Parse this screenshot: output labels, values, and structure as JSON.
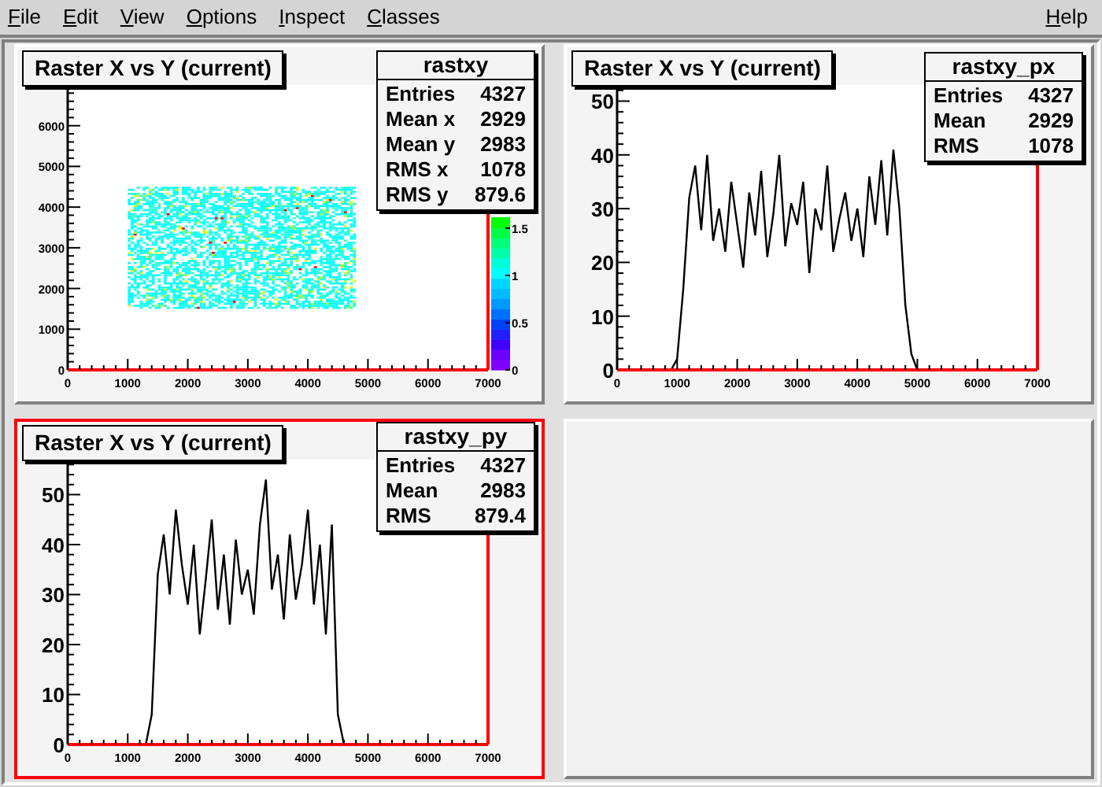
{
  "menu": {
    "items": [
      "File",
      "Edit",
      "View",
      "Options",
      "Inspect",
      "Classes"
    ],
    "help": "Help"
  },
  "pads": [
    {
      "kind": "hist2d",
      "selected": false,
      "title": "Raster X vs Y (current)",
      "stats": {
        "name": "rastxy",
        "rows": [
          {
            "label": "Entries",
            "value": "4327"
          },
          {
            "label": "Mean x",
            "value": "2929"
          },
          {
            "label": "Mean y",
            "value": "2983"
          },
          {
            "label": "RMS x",
            "value": "1078"
          },
          {
            "label": "RMS y",
            "value": "879.6"
          }
        ]
      },
      "palette_ticks": [
        "1.5",
        "1",
        "0.5",
        "0"
      ],
      "axes": {
        "xticks": [
          "0",
          "1000",
          "2000",
          "3000",
          "4000",
          "5000",
          "6000",
          "7000"
        ],
        "yticks": [
          "6000",
          "5000",
          "4000",
          "3000",
          "2000",
          "1000",
          "0"
        ]
      }
    },
    {
      "kind": "hist1d",
      "selected": false,
      "title": "Raster X vs Y (current)",
      "stats": {
        "name": "rastxy_px",
        "rows": [
          {
            "label": "Entries",
            "value": "4327"
          },
          {
            "label": "Mean",
            "value": "2929"
          },
          {
            "label": "RMS",
            "value": "1078"
          }
        ]
      },
      "chart_data": {
        "type": "line",
        "xlim": [
          0,
          7000
        ],
        "ylim": [
          0,
          53
        ],
        "xticks": [
          0,
          1000,
          2000,
          3000,
          4000,
          5000,
          6000,
          7000
        ],
        "yticks": [
          0,
          10,
          20,
          30,
          40,
          50
        ],
        "x": [
          0,
          100,
          200,
          300,
          400,
          500,
          600,
          700,
          800,
          900,
          1000,
          1100,
          1200,
          1300,
          1400,
          1500,
          1600,
          1700,
          1800,
          1900,
          2000,
          2100,
          2200,
          2300,
          2400,
          2500,
          2600,
          2700,
          2800,
          2900,
          3000,
          3100,
          3200,
          3300,
          3400,
          3500,
          3600,
          3700,
          3800,
          3900,
          4000,
          4100,
          4200,
          4300,
          4400,
          4500,
          4600,
          4700,
          4800,
          4900,
          5000,
          5100,
          5200,
          5300,
          5400,
          5500,
          5600,
          5700,
          5800,
          5900,
          6000,
          6100,
          6200,
          6300,
          6400,
          6500,
          6600,
          6700,
          6800,
          6900
        ],
        "series": [
          {
            "color": "#000000",
            "values": [
              0,
              0,
              0,
              0,
              0,
              0,
              0,
              0,
              0,
              0,
              2,
              15,
              32,
              38,
              26,
              40,
              24,
              30,
              22,
              35,
              27,
              19,
              33,
              25,
              37,
              21,
              29,
              40,
              23,
              31,
              27,
              35,
              18,
              30,
              26,
              38,
              22,
              28,
              33,
              24,
              30,
              21,
              36,
              27,
              39,
              25,
              41,
              30,
              12,
              3,
              0,
              0,
              0,
              0,
              0,
              0,
              0,
              0,
              0,
              0,
              0,
              0,
              0,
              0,
              0,
              0,
              0,
              0,
              0,
              0
            ]
          }
        ]
      }
    },
    {
      "kind": "hist1d",
      "selected": true,
      "title": "Raster X vs Y (current)",
      "stats": {
        "name": "rastxy_py",
        "rows": [
          {
            "label": "Entries",
            "value": "4327"
          },
          {
            "label": "Mean",
            "value": "2983"
          },
          {
            "label": "RMS",
            "value": "879.4"
          }
        ]
      },
      "chart_data": {
        "type": "line",
        "xlim": [
          0,
          7000
        ],
        "ylim": [
          0,
          57
        ],
        "xticks": [
          0,
          1000,
          2000,
          3000,
          4000,
          5000,
          6000,
          7000
        ],
        "yticks": [
          0,
          10,
          20,
          30,
          40,
          50
        ],
        "x": [
          0,
          100,
          200,
          300,
          400,
          500,
          600,
          700,
          800,
          900,
          1000,
          1100,
          1200,
          1300,
          1400,
          1500,
          1600,
          1700,
          1800,
          1900,
          2000,
          2100,
          2200,
          2300,
          2400,
          2500,
          2600,
          2700,
          2800,
          2900,
          3000,
          3100,
          3200,
          3300,
          3400,
          3500,
          3600,
          3700,
          3800,
          3900,
          4000,
          4100,
          4200,
          4300,
          4400,
          4500,
          4600,
          4700,
          4800,
          4900,
          5000,
          5100,
          5200,
          5300,
          5400,
          5500,
          5600,
          5700,
          5800,
          5900,
          6000,
          6100,
          6200,
          6300,
          6400,
          6500,
          6600,
          6700,
          6800,
          6900
        ],
        "series": [
          {
            "color": "#000000",
            "values": [
              0,
              0,
              0,
              0,
              0,
              0,
              0,
              0,
              0,
              0,
              0,
              0,
              0,
              0,
              6,
              34,
              42,
              30,
              47,
              36,
              28,
              40,
              22,
              33,
              45,
              27,
              38,
              24,
              41,
              30,
              35,
              26,
              44,
              53,
              31,
              38,
              25,
              42,
              29,
              36,
              47,
              28,
              40,
              22,
              44,
              6,
              0,
              0,
              0,
              0,
              0,
              0,
              0,
              0,
              0,
              0,
              0,
              0,
              0,
              0,
              0,
              0,
              0,
              0,
              0,
              0,
              0,
              0,
              0,
              0
            ]
          }
        ]
      }
    },
    {
      "kind": "empty",
      "selected": false
    }
  ]
}
